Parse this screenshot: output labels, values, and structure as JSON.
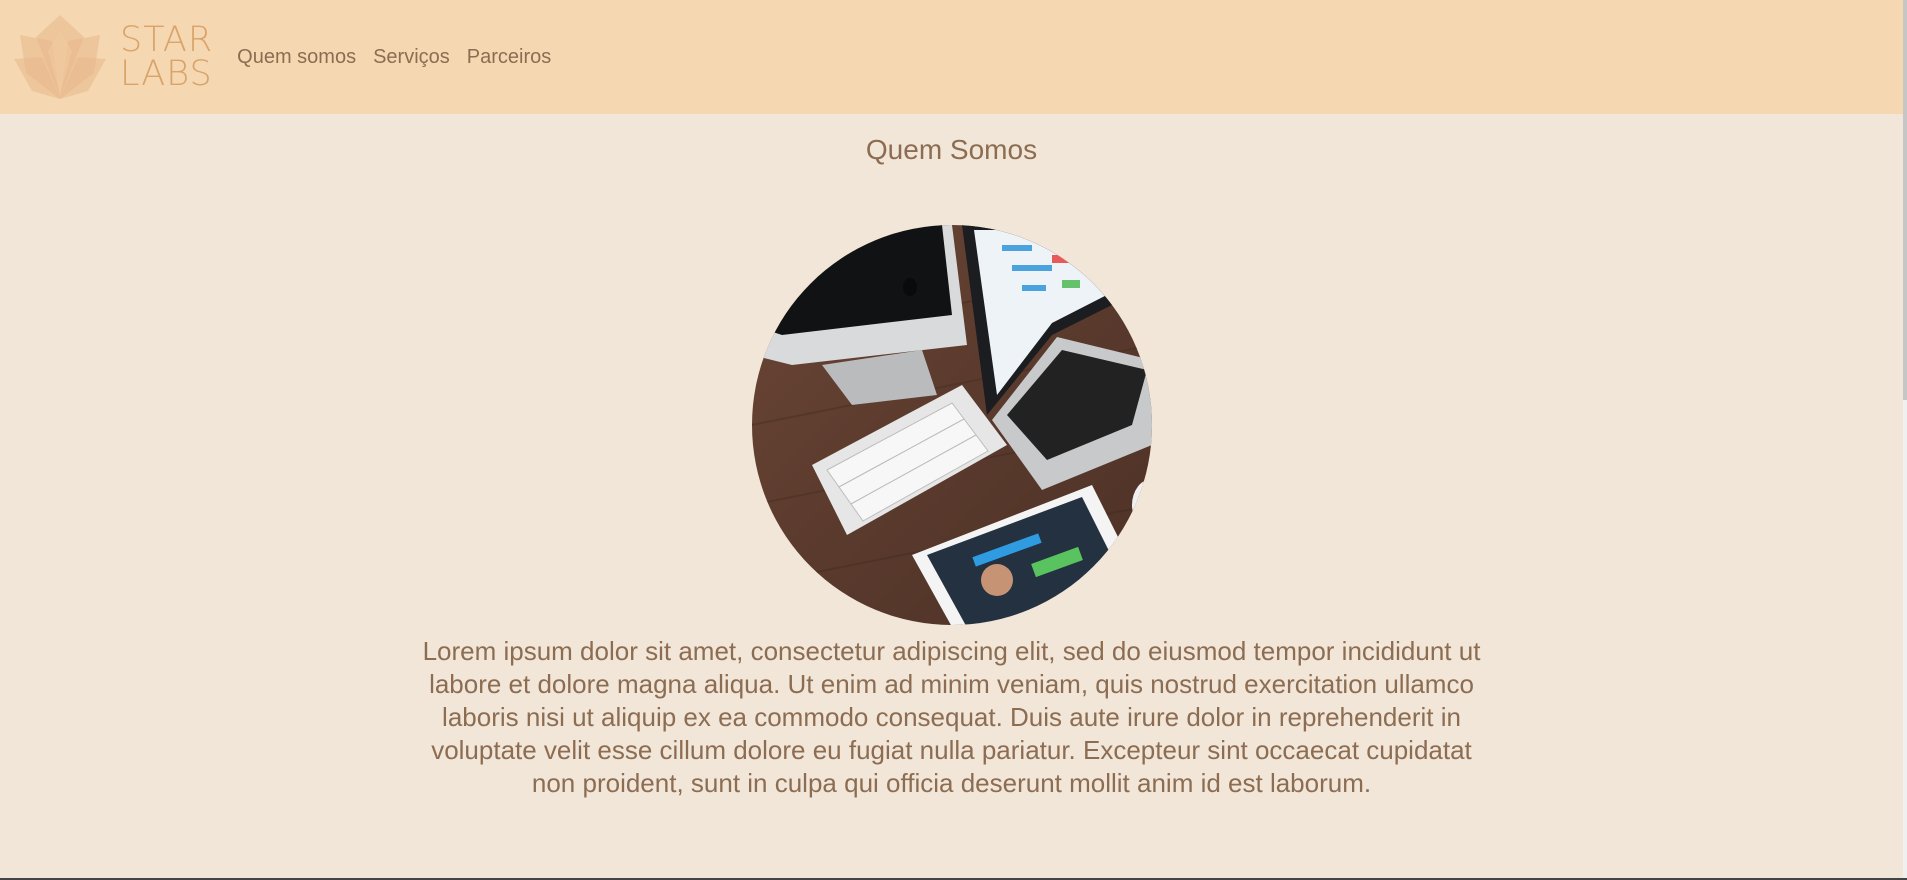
{
  "brand": {
    "line1": "STAR",
    "line2": "LABS",
    "logo_icon": "lotus-logo-icon",
    "logo_color": "#d9a36a"
  },
  "nav": {
    "items": [
      {
        "label": "Quem somos"
      },
      {
        "label": "Serviços"
      },
      {
        "label": "Parceiros"
      }
    ]
  },
  "main": {
    "title": "Quem Somos",
    "image_icon": "desk-devices-photo",
    "paragraph": "Lorem ipsum dolor sit amet, consectetur adipiscing elit, sed do eiusmod tempor incididunt ut labore et dolore magna aliqua. Ut enim ad minim veniam, quis nostrud exercitation ullamco laboris nisi ut aliquip ex ea commodo consequat. Duis aute irure dolor in reprehenderit in voluptate velit esse cillum dolore eu fugiat nulla pariatur. Excepteur sint occaecat cupidatat non proident, sunt in culpa qui officia deserunt mollit anim id est laborum."
  },
  "colors": {
    "header_bg": "#f5d7b1",
    "page_bg": "#f2e6d9",
    "text": "#8c6d52"
  }
}
